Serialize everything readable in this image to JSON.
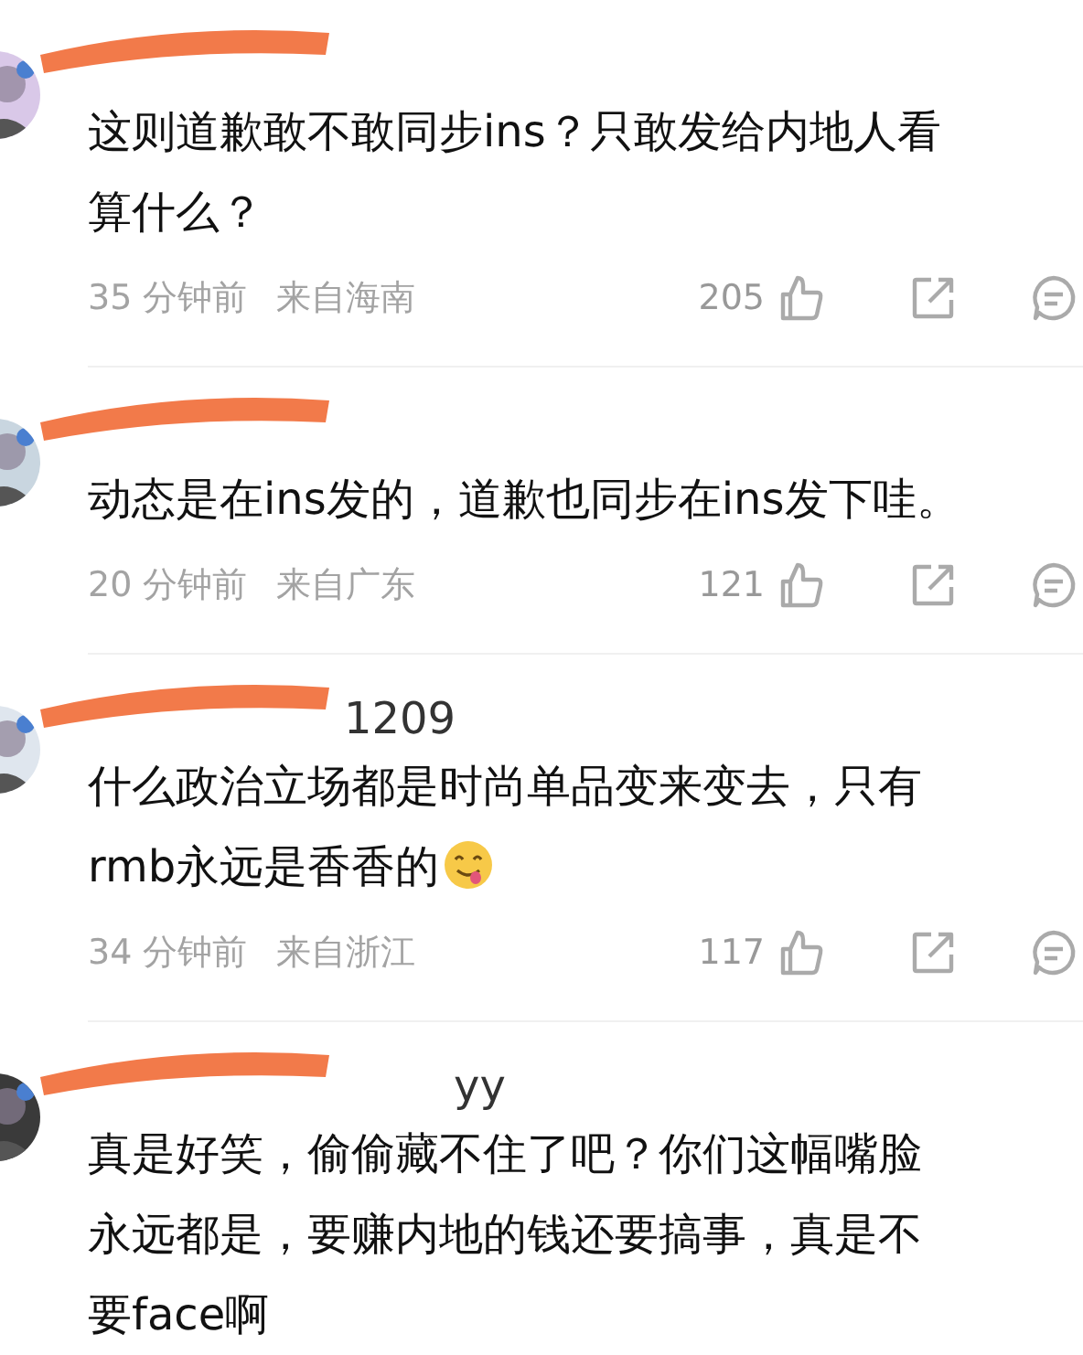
{
  "comments": [
    {
      "redacted": true,
      "lines": [
        "这则道歉敢不敢同步ins？只敢发给内地人看",
        "算什么？"
      ],
      "time": "35 分钟前",
      "location": "来自海南",
      "likes": "205"
    },
    {
      "redacted": true,
      "lines": [
        "动态是在ins发的，道歉也同步在ins发下哇。"
      ],
      "time": "20 分钟前",
      "location": "来自广东",
      "likes": "121"
    },
    {
      "redacted": true,
      "name_fragment": "1209",
      "lines": [
        "什么政治立场都是时尚单品变来变去，只有",
        "rmb永远是香香的"
      ],
      "ends_with_emoji": true,
      "time": "34 分钟前",
      "location": "来自浙江",
      "likes": "117"
    },
    {
      "redacted": true,
      "name_fragment": "yy",
      "lines": [
        "真是好笑，偷偷藏不住了吧？你们这幅嘴脸",
        "永远都是，要赚内地的钱还要搞事，真是不",
        "要face啊"
      ]
    }
  ]
}
